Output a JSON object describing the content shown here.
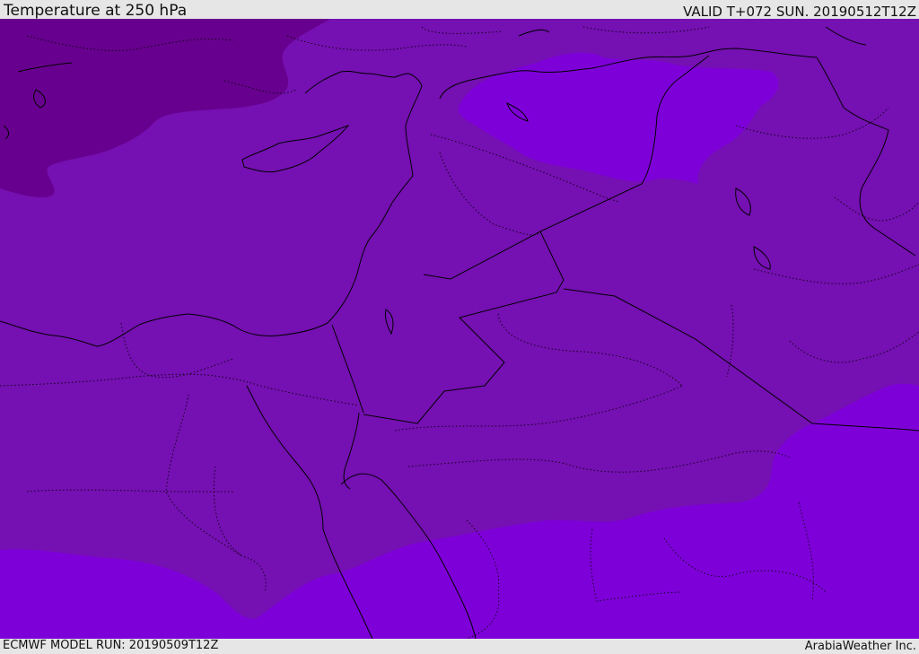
{
  "header": {
    "title": "Temperature at 250 hPa",
    "valid": "VALID T+072 SUN. 20190512T12Z"
  },
  "footer": {
    "model_run": "ECMWF MODEL RUN: 20190509T12Z",
    "credit": "ArabiaWeather Inc."
  },
  "colors": {
    "band_mid": "#7510b2",
    "band_cold": "#68008f",
    "band_warm": "#7e00d9",
    "borders": "#000000",
    "frame": "#e6e6e6"
  }
}
